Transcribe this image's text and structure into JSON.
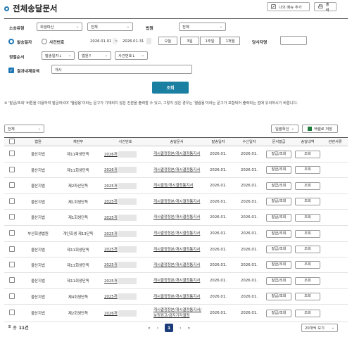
{
  "page": {
    "title": "전체송달문서",
    "menu_add_label": "나의 메뉴 추가",
    "print_label": "출력"
  },
  "filters": {
    "case_type_label": "소송유형",
    "case_type_value": "회생파산",
    "case_type_sub_value": "전체",
    "court_label": "법원",
    "court_value": "전체",
    "period_type_radio_1": "발송일자",
    "period_type_radio_2": "사건번호",
    "date_from": "2026.01.01",
    "date_to": "2026.01.31",
    "date_separator": "~",
    "quick_periods": [
      "오늘",
      "3일",
      "1주일",
      "1개월"
    ],
    "party_label": "당사자명",
    "party_value": "",
    "sort_label": "정렬순서",
    "sort_1": "발송일자↓",
    "sort_2": "법원↑",
    "sort_3": "사건번호↓",
    "result_search_label": "결과내재검색",
    "result_search_value": "개시"
  },
  "search_button": "조회",
  "notice_text": "※ '발급/조회' 버튼을 이용하여 발급하셔야 '열람용'이라는 문구가 기재되지 않은 진본을 출력할 수 있고, 그렇지 않은 경우는 '열람용'이라는 문구가 포함되어 출력되는 점에 유의하시기 바랍니다.",
  "table_filter_value": "전체",
  "bulk_view_label": "일괄확인",
  "excel_save_label": "엑셀로 저장",
  "table": {
    "headers": [
      "",
      "법원",
      "재판부",
      "사건번호",
      "송달문서",
      "발송일자",
      "수신일자",
      "문서발급",
      "송달내역",
      "관련서류"
    ],
    "rows": [
      {
        "court": "울산지법",
        "division": "제11파생단독",
        "case_no": "2026개",
        "doc": "개시결정정본/개시결정통지서",
        "sent": "2026.01.",
        "recv": "2026.01.",
        "issue": "발급/조회",
        "history": "조회"
      },
      {
        "court": "울산지법",
        "division": "제11회생단독",
        "case_no": "2026개",
        "doc": "개시결정정본/개시결정통지서",
        "sent": "2026.01.",
        "recv": "2026.01.",
        "issue": "발급/조회",
        "history": "조회"
      },
      {
        "court": "울산지법",
        "division": "제2파산단독",
        "case_no": "2025개",
        "doc": "개시결정/개시결정통지서",
        "sent": "2026.01.",
        "recv": "2026.01.",
        "issue": "발급/조회",
        "history": "조회"
      },
      {
        "court": "울산지법",
        "division": "제1회생단독",
        "case_no": "2025개",
        "doc": "개시결정정본/개시결정통지서",
        "sent": "2026.01.",
        "recv": "2026.01.",
        "issue": "발급/조회",
        "history": "조회"
      },
      {
        "court": "울산지법",
        "division": "제1회생단독",
        "case_no": "2025개",
        "doc": "개시결정정본/개시결정통지서",
        "sent": "2026.01.",
        "recv": "2026.01.",
        "issue": "발급/조회",
        "history": "조회"
      },
      {
        "court": "부산회생법원",
        "division": "개인회생 제13단독",
        "case_no": "2025개",
        "doc": "개시결정정본/개시결정통지서",
        "sent": "2026.01.",
        "recv": "2026.01.",
        "issue": "발급/조회",
        "history": "조회"
      },
      {
        "court": "울산지법",
        "division": "제11회생단독",
        "case_no": "2025개",
        "doc": "개시결정정본/개시결정통지서",
        "sent": "2026.01.",
        "recv": "2026.01.",
        "issue": "발급/조회",
        "history": "조회"
      },
      {
        "court": "울산지법",
        "division": "제11회생단독",
        "case_no": "2025개",
        "doc": "개시결정정본/개시결정통지서",
        "sent": "2026.01.",
        "recv": "2026.01.",
        "issue": "발급/조회",
        "history": "조회"
      },
      {
        "court": "울산지법",
        "division": "제11회생단독",
        "case_no": "2025개",
        "doc": "개시결정정본/개시결정통지서",
        "sent": "2026.01.",
        "recv": "2026.01.",
        "issue": "발급/조회",
        "history": "조회"
      },
      {
        "court": "울산지법",
        "division": "제4회생단독",
        "case_no": "2025개",
        "doc": "개시결정정본/개시결정통지서",
        "sent": "2026.01.",
        "recv": "2026.01.",
        "issue": "발급/조회",
        "history": "조회"
      },
      {
        "court": "울산지법",
        "division": "제2회생단독",
        "case_no": "2026개",
        "doc": "개시결정정본/개시결정통지서/보정권고/금지기각결정",
        "sent": "2026.01.",
        "recv": "2026.01.",
        "issue": "발급/조회",
        "history": "조회"
      }
    ]
  },
  "footer": {
    "total_label": "총",
    "total_count": "11건",
    "current_page": "1",
    "page_size": "20개씩 보기"
  }
}
